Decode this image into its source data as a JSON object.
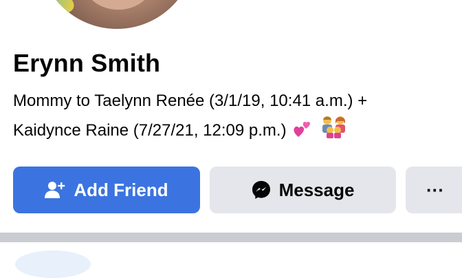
{
  "profile": {
    "name": "Erynn Smith",
    "bio_line1": "Mommy to Taelynn Renée (3/1/19, 10:41 a.m.) +",
    "bio_line2": "Kaidynce Raine (7/27/21, 12:09 p.m.)",
    "bio_emojis": [
      "two-hearts-icon",
      "family-icon"
    ]
  },
  "actions": {
    "add_friend_label": "Add Friend",
    "message_label": "Message",
    "more_label": "···"
  },
  "colors": {
    "primary_button": "#3b74e0",
    "secondary_button": "#e4e6eb",
    "divider": "#c9ccd1"
  },
  "icons": {
    "add_friend": "add-user-icon",
    "message": "messenger-icon",
    "more": "more-dots-icon"
  }
}
